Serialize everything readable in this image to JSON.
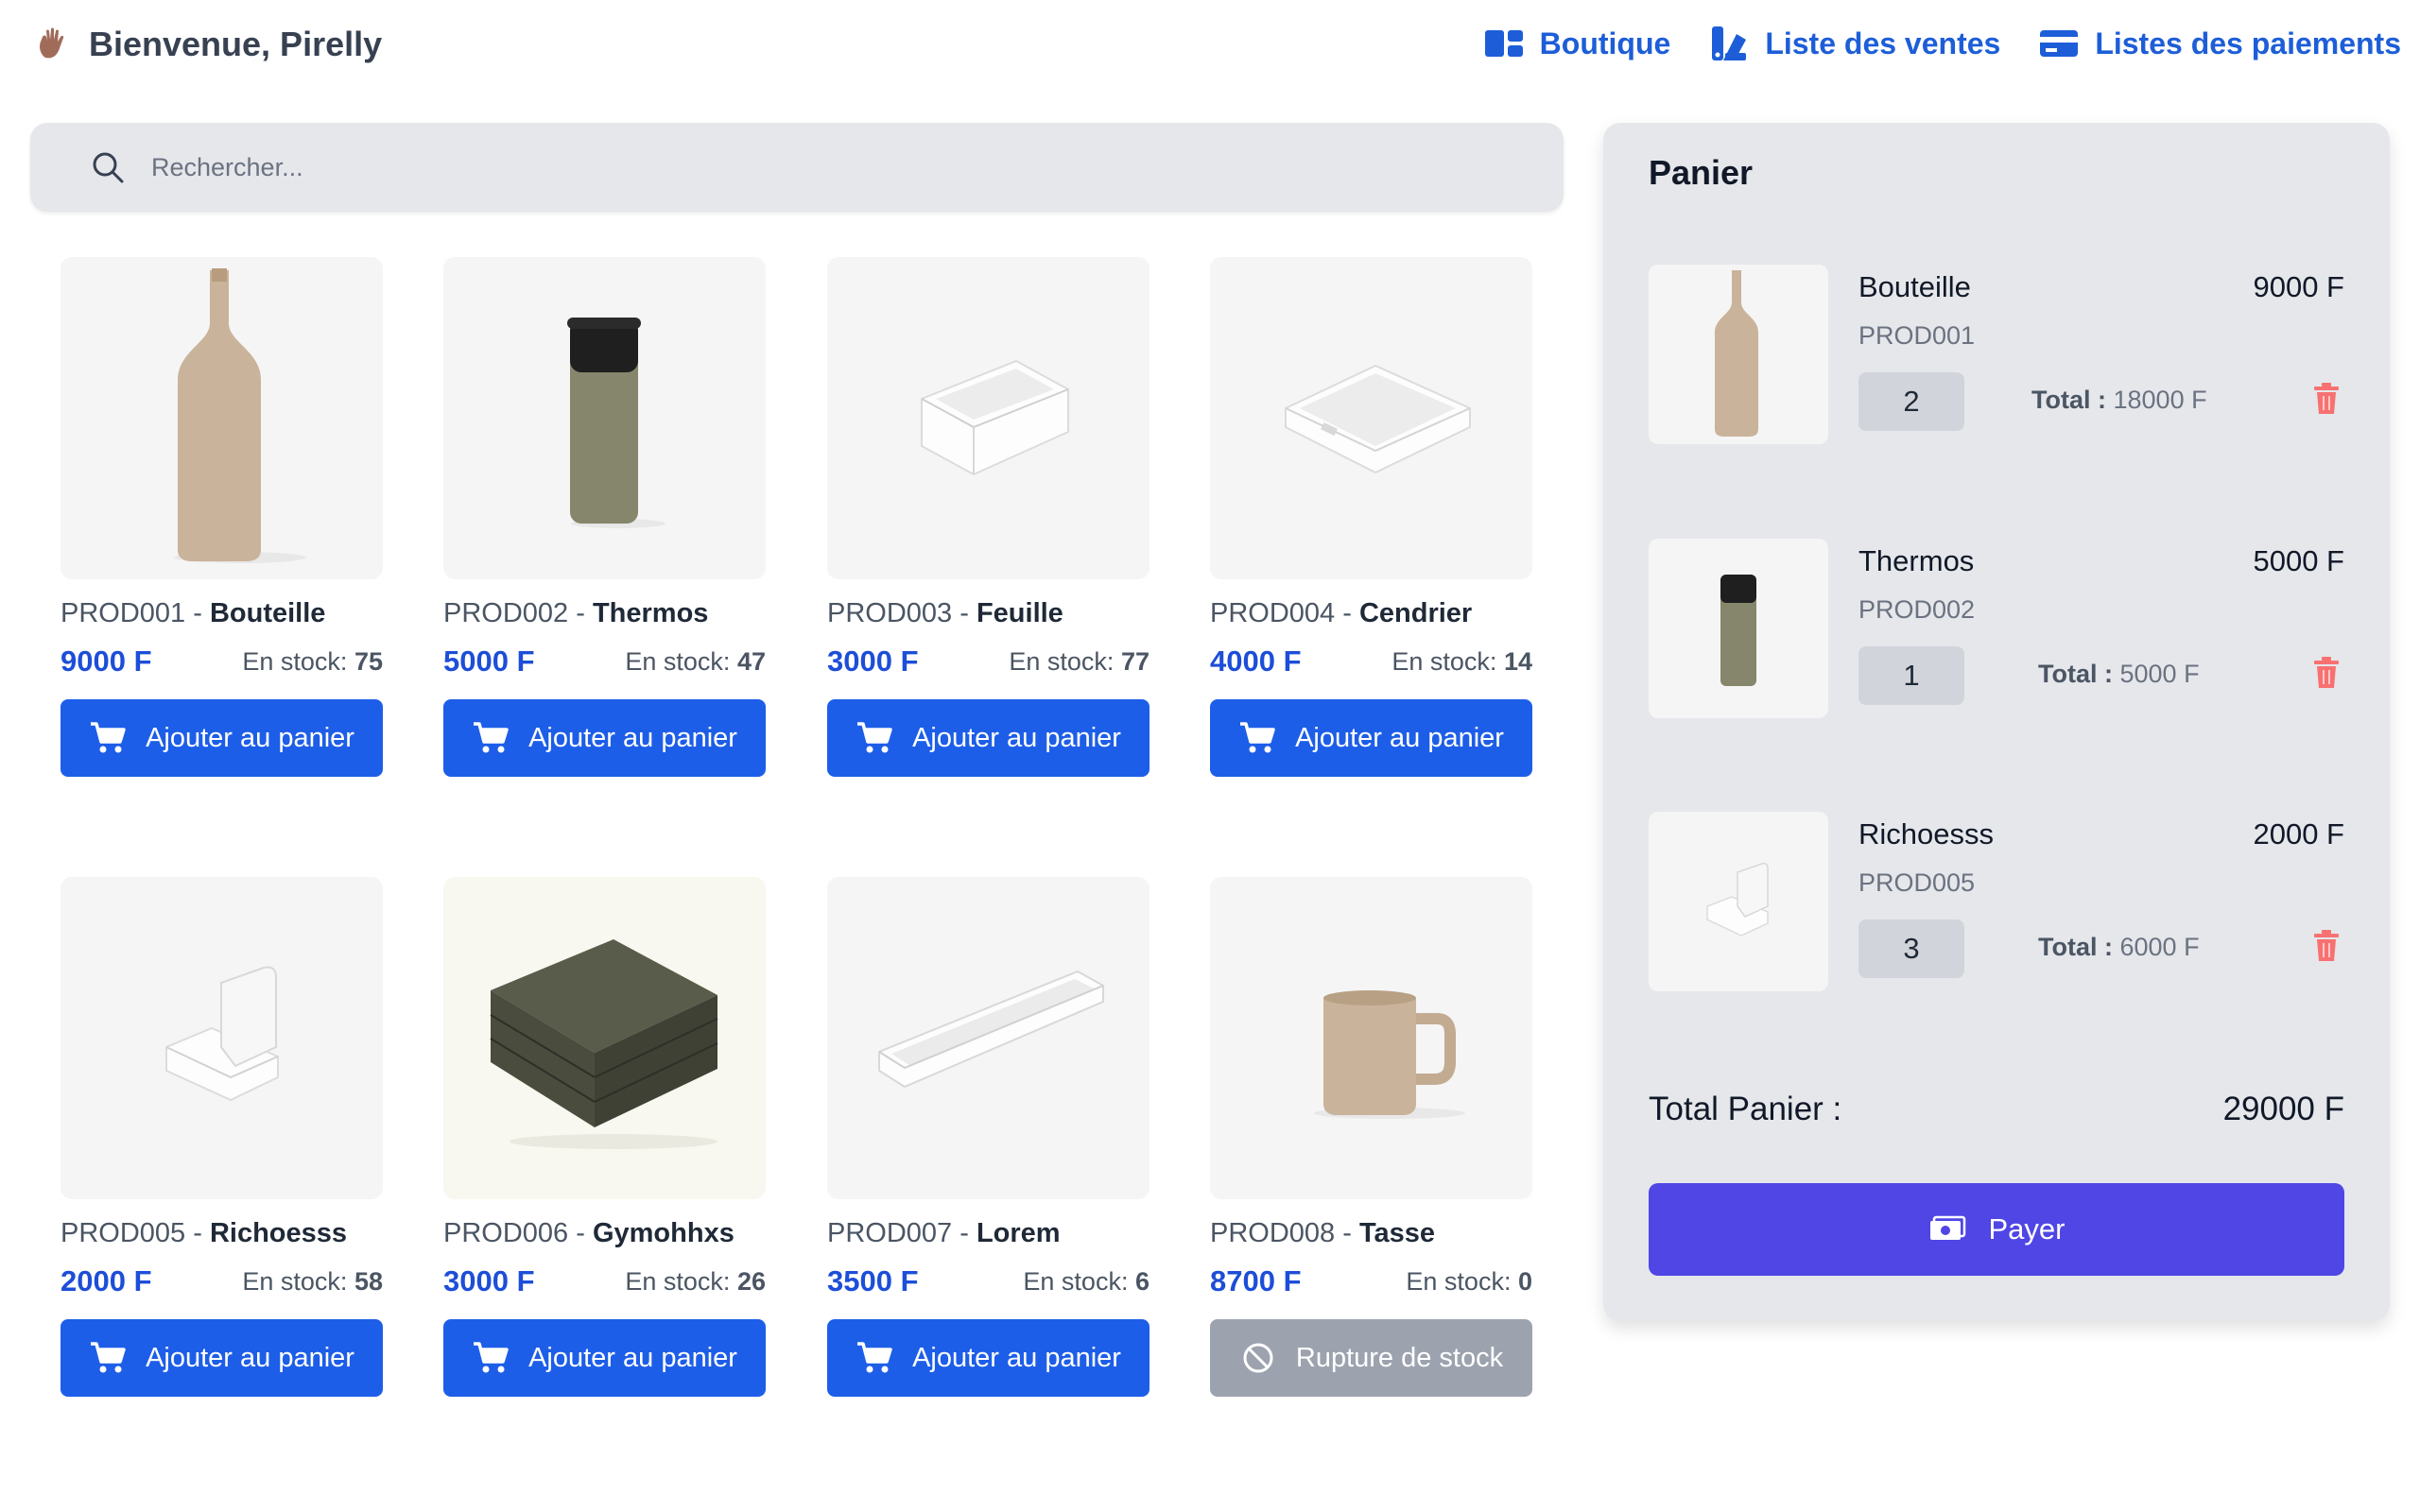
{
  "header": {
    "greeting": "Bienvenue, Pirelly",
    "nav": [
      {
        "label": "Boutique",
        "icon": "shop-grid-icon"
      },
      {
        "label": "Liste des ventes",
        "icon": "sales-list-icon"
      },
      {
        "label": "Listes des paiements",
        "icon": "credit-card-icon"
      }
    ]
  },
  "search": {
    "placeholder": "Rechercher..."
  },
  "products": [
    {
      "code": "PROD001",
      "name": "Bouteille",
      "price": "9000 F",
      "stock_label": "En stock:",
      "stock": "75",
      "button": "Ajouter au panier",
      "image": "bottle"
    },
    {
      "code": "PROD002",
      "name": "Thermos",
      "price": "5000 F",
      "stock_label": "En stock:",
      "stock": "47",
      "button": "Ajouter au panier",
      "image": "thermos"
    },
    {
      "code": "PROD003",
      "name": "Feuille",
      "price": "3000 F",
      "stock_label": "En stock:",
      "stock": "77",
      "button": "Ajouter au panier",
      "image": "tray-box"
    },
    {
      "code": "PROD004",
      "name": "Cendrier",
      "price": "4000 F",
      "stock_label": "En stock:",
      "stock": "14",
      "button": "Ajouter au panier",
      "image": "ashtray"
    },
    {
      "code": "PROD005",
      "name": "Richoesss",
      "price": "2000 F",
      "stock_label": "En stock:",
      "stock": "58",
      "button": "Ajouter au panier",
      "image": "phone-stand"
    },
    {
      "code": "PROD006",
      "name": "Gymohhxs",
      "price": "3000 F",
      "stock_label": "En stock:",
      "stock": "26",
      "button": "Ajouter au panier",
      "image": "book-stack"
    },
    {
      "code": "PROD007",
      "name": "Lorem",
      "price": "3500 F",
      "stock_label": "En stock:",
      "stock": "6",
      "button": "Ajouter au panier",
      "image": "long-tray"
    },
    {
      "code": "PROD008",
      "name": "Tasse",
      "price": "8700 F",
      "stock_label": "En stock:",
      "stock": "0",
      "button": "Rupture de stock",
      "image": "mug",
      "out_of_stock": true
    }
  ],
  "cart": {
    "title": "Panier",
    "items": [
      {
        "name": "Bouteille",
        "price": "9000 F",
        "code": "PROD001",
        "qty": "2",
        "total_label": "Total :",
        "total": "18000 F"
      },
      {
        "name": "Thermos",
        "price": "5000 F",
        "code": "PROD002",
        "qty": "1",
        "total_label": "Total :",
        "total": "5000 F"
      },
      {
        "name": "Richoesss",
        "price": "2000 F",
        "code": "PROD005",
        "qty": "3",
        "total_label": "Total :",
        "total": "6000 F"
      }
    ],
    "total_label": "Total Panier :",
    "total_value": "29000 F",
    "pay_label": "Payer"
  },
  "colors": {
    "primary": "#1d5ee8",
    "pay": "#4f46e5",
    "disabled": "#9ca3af",
    "trash": "#f87171"
  }
}
